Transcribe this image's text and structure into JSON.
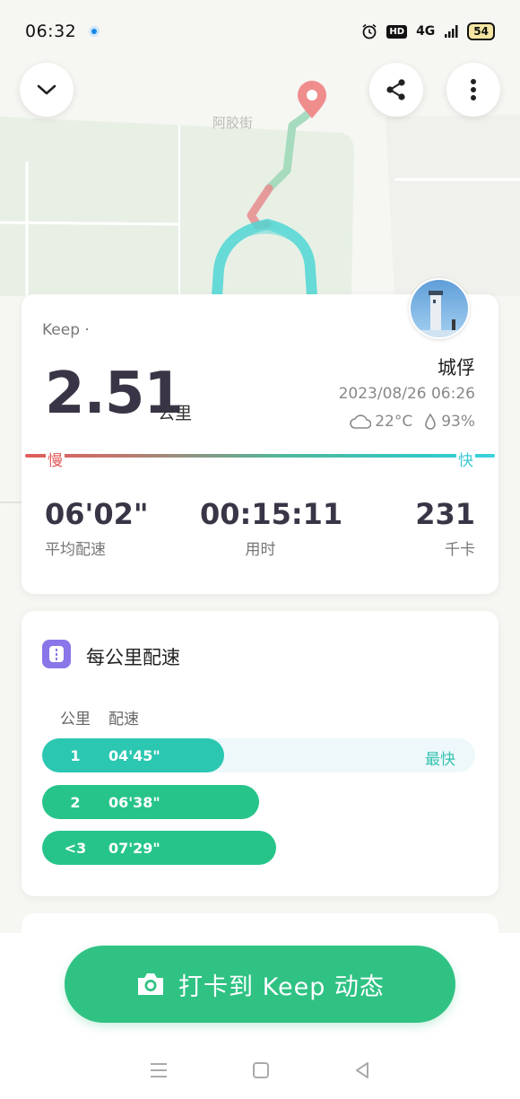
{
  "status_bar": {
    "time": "06:32",
    "network": "4G",
    "hd_label": "HD",
    "battery": "54"
  },
  "map": {
    "street_label": "阿胶街",
    "route_colors": [
      "#9ed8b9",
      "#e59191",
      "#4fd6d2"
    ]
  },
  "summary": {
    "brand": "Keep ·",
    "distance": "2.51",
    "distance_unit": "公里",
    "username": "城俘",
    "datetime": "2023/08/26 06:26",
    "temperature": "22°C",
    "humidity": "93%",
    "slow_label": "慢",
    "fast_label": "快",
    "stats": [
      {
        "value": "06'02\"",
        "label": "平均配速"
      },
      {
        "value": "00:15:11",
        "label": "用时"
      },
      {
        "value": "231",
        "label": "千卡"
      }
    ]
  },
  "pace_section": {
    "title": "每公里配速",
    "col_km": "公里",
    "col_pace": "配速",
    "fastest_tag": "最快",
    "rows": [
      {
        "km": "1",
        "pace": "04'45\"",
        "fill_percent": 42,
        "color": "#2bc7b1",
        "fastest": true
      },
      {
        "km": "2",
        "pace": "06'38\"",
        "fill_percent": 50,
        "color": "#27c48a",
        "fastest": false
      },
      {
        "km": "<3",
        "pace": "07'29\"",
        "fill_percent": 54,
        "color": "#27c48a",
        "fastest": false
      }
    ]
  },
  "checkin_button": {
    "label": "打卡到 Keep 动态",
    "color": "#2fc283"
  },
  "icons": {
    "collapse": "chevron-down-icon",
    "share": "share-icon",
    "more": "more-vertical-icon",
    "camera": "camera-icon",
    "cloud": "cloud-icon",
    "drop": "drop-icon"
  }
}
